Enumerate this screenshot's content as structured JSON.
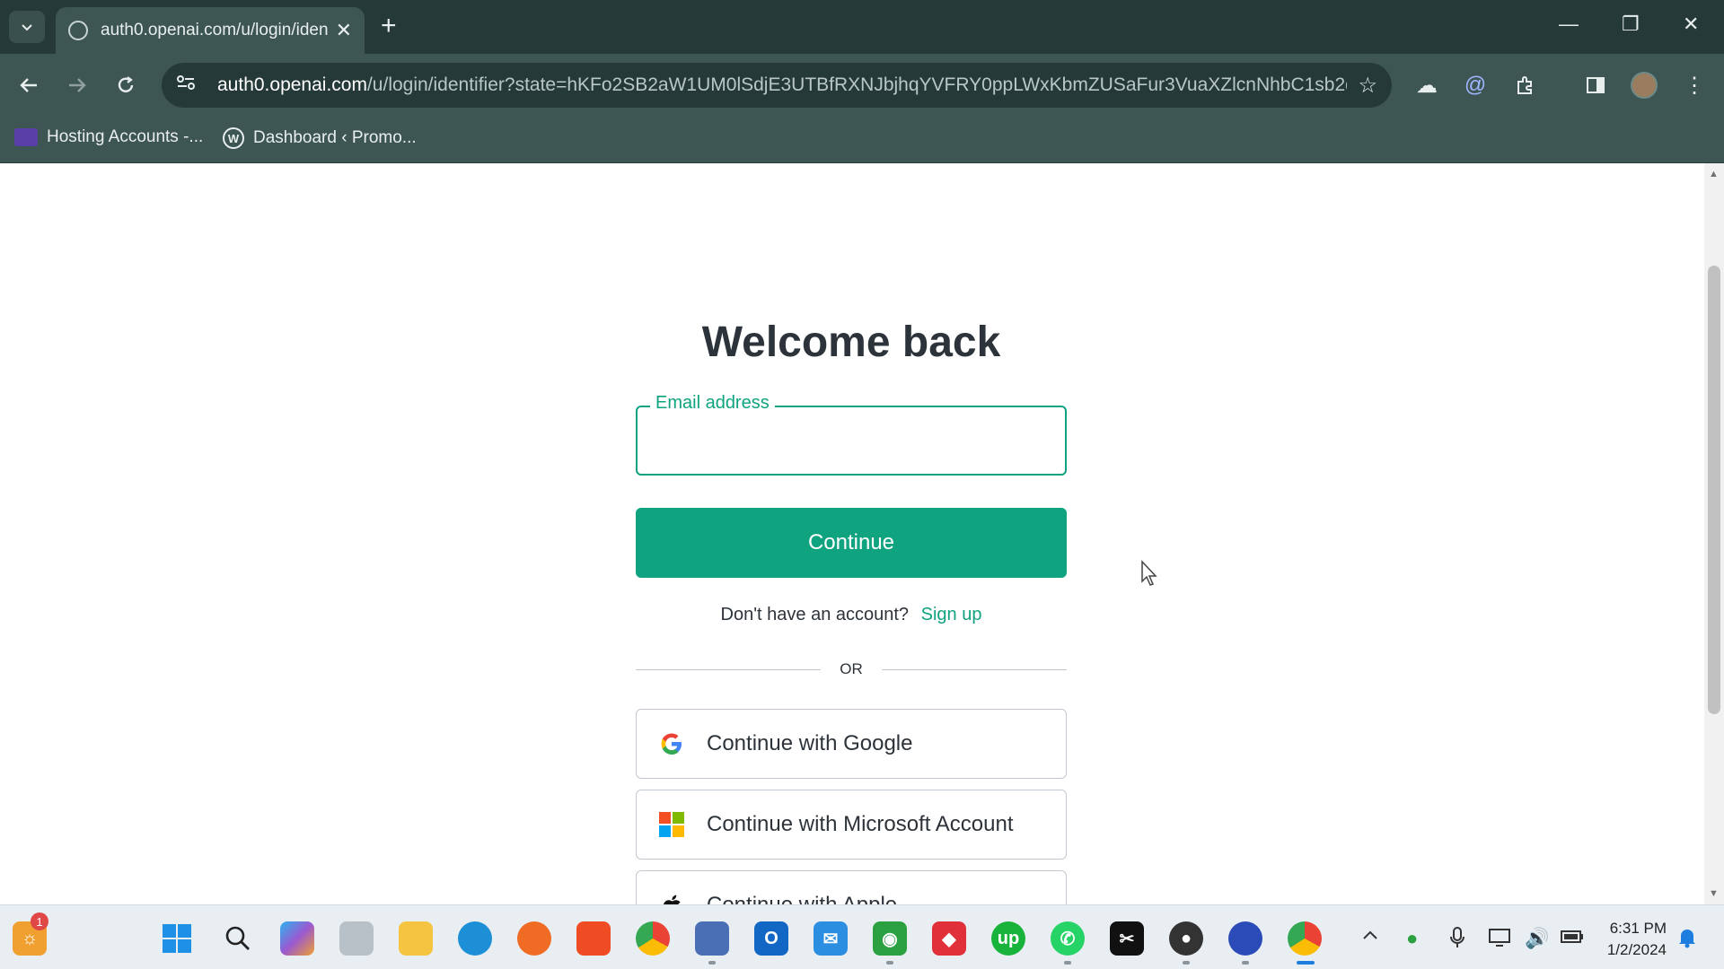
{
  "browser": {
    "tab_title": "auth0.openai.com/u/login/iden",
    "url_host": "auth0.openai.com",
    "url_path": "/u/login/identifier?state=hKFo2SB2aW1UM0lSdjE3UTBfRXNJbjhqYVFRY0ppLWxKbmZUSaFur3VuaXZlcnNhbC1sb2dp...",
    "bookmarks": [
      {
        "label": "Hosting Accounts -..."
      },
      {
        "label": "Dashboard ‹ Promo..."
      }
    ]
  },
  "login": {
    "heading": "Welcome back",
    "email_label": "Email address",
    "email_value": "",
    "continue_label": "Continue",
    "signup_prompt": "Don't have an account?",
    "signup_link": "Sign up",
    "or_text": "OR",
    "google_label": "Continue with Google",
    "microsoft_label": "Continue with Microsoft Account",
    "apple_label": "Continue with Apple"
  },
  "taskbar": {
    "notification_count": "1",
    "time": "6:31 PM",
    "date": "1/2/2024"
  },
  "colors": {
    "accent": "#10a37f",
    "chrome_dark": "#253a38",
    "chrome_light": "#3e5653"
  }
}
